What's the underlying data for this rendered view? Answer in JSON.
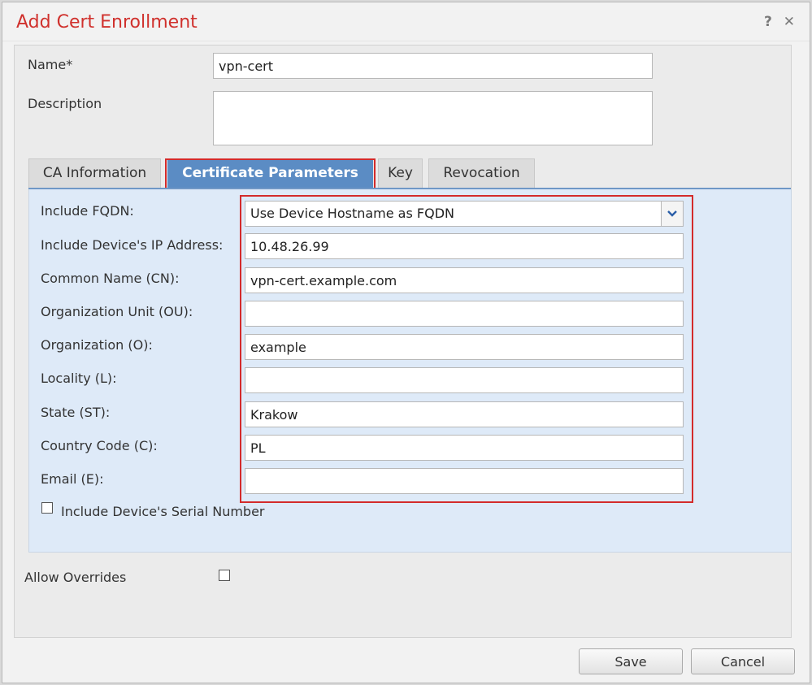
{
  "dialog": {
    "title": "Add Cert Enrollment",
    "help_icon": "?",
    "close_icon": "✕"
  },
  "form": {
    "name_label": "Name*",
    "name_value": "vpn-cert",
    "description_label": "Description",
    "description_value": ""
  },
  "tabs": [
    {
      "label": "CA Information",
      "active": false
    },
    {
      "label": "Certificate Parameters",
      "active": true
    },
    {
      "label": "Key",
      "active": false
    },
    {
      "label": "Revocation",
      "active": false
    }
  ],
  "cert_params": {
    "fqdn": {
      "label": "Include FQDN:",
      "value": "Use Device Hostname as FQDN"
    },
    "ip": {
      "label": "Include Device's IP Address:",
      "value": "10.48.26.99"
    },
    "cn": {
      "label": "Common Name (CN):",
      "value": "vpn-cert.example.com"
    },
    "ou": {
      "label": "Organization Unit (OU):",
      "value": ""
    },
    "o": {
      "label": "Organization (O):",
      "value": "example"
    },
    "l": {
      "label": "Locality (L):",
      "value": ""
    },
    "st": {
      "label": "State (ST):",
      "value": "Krakow"
    },
    "c": {
      "label": "Country Code (C):",
      "value": "PL"
    },
    "e": {
      "label": "Email (E):",
      "value": ""
    },
    "serial_label": "Include Device's Serial Number",
    "serial_checked": false
  },
  "allow_overrides": {
    "label": "Allow Overrides",
    "checked": false
  },
  "buttons": {
    "save": "Save",
    "cancel": "Cancel"
  },
  "colors": {
    "title": "#d0312d",
    "active_tab": "#5b8cc4",
    "panel": "#deeaf8",
    "highlight": "#d32b2b"
  }
}
